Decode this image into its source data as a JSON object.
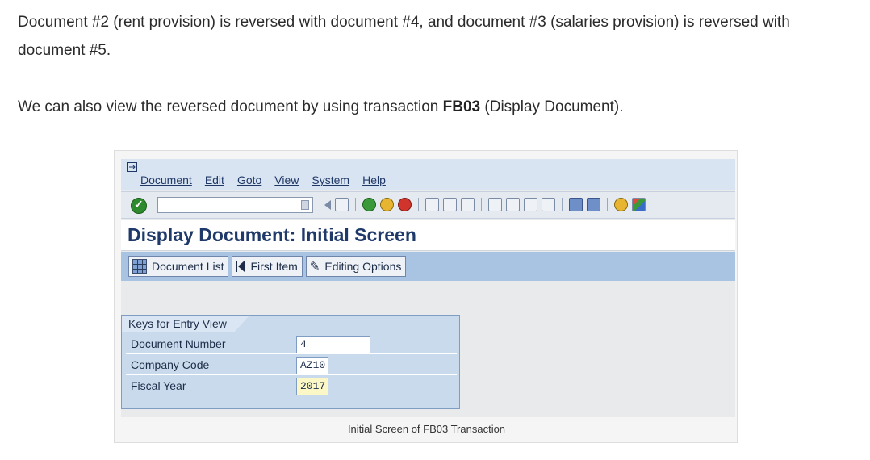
{
  "article": {
    "paragraph1": "Document #2 (rent provision) is reversed with document #4, and document #3 (salaries provision) is reversed with document #5.",
    "paragraph2_before": "We can also view the reversed document by using transaction ",
    "paragraph2_bold": "FB03",
    "paragraph2_after": " (Display Document)."
  },
  "sap": {
    "menu": [
      "Document",
      "Edit",
      "Goto",
      "View",
      "System",
      "Help"
    ],
    "command_field_value": "",
    "screen_title": "Display Document: Initial Screen",
    "app_toolbar": {
      "document_list": "Document List",
      "first_item": "First Item",
      "editing_options": "Editing Options"
    },
    "keys_section": {
      "title": "Keys for Entry View",
      "document_number_label": "Document Number",
      "document_number_value": "4",
      "company_code_label": "Company Code",
      "company_code_value": "AZ10",
      "fiscal_year_label": "Fiscal Year",
      "fiscal_year_value": "2017"
    }
  },
  "caption": "Initial Screen of FB03 Transaction",
  "colors": {
    "menubar": "#d9e4f3",
    "app_toolbar": "#a9c3e3",
    "title_text": "#1f3a6a",
    "key_box": "#c9daec",
    "required_field": "#fbf7c7"
  },
  "icons": {
    "toolbar": [
      "enter-icon",
      "save-icon",
      "back-icon",
      "exit-icon",
      "cancel-icon",
      "print-icon",
      "find-icon",
      "find-next-icon",
      "first-page-icon",
      "previous-page-icon",
      "next-page-icon",
      "last-page-icon",
      "create-session-icon",
      "shortcut-icon",
      "help-icon",
      "layout-menu-icon"
    ]
  }
}
